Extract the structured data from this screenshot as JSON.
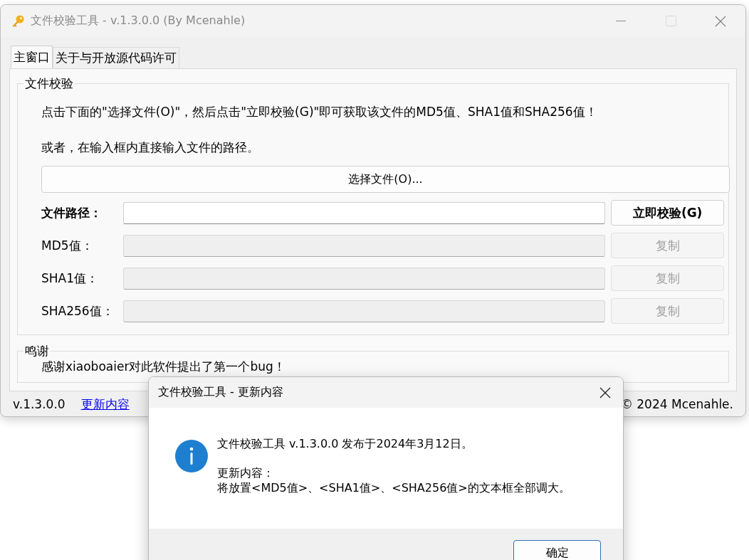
{
  "window": {
    "title": "文件校验工具 - v.1.3.0.0 (By Mcenahle)",
    "active": false,
    "maximize_disabled": true
  },
  "tabs": [
    {
      "label": "主窗口",
      "selected": true
    },
    {
      "label": "关于与开放源代码许可",
      "selected": false
    }
  ],
  "check_group": {
    "title": "文件校验",
    "lines": [
      "点击下面的\"选择文件(O)\"，然后点击\"立即校验(G)\"即可获取该文件的MD5值、SHA1值和SHA256值！",
      "或者，在输入框内直接输入文件的路径。"
    ],
    "choose_button": "选择文件(O)...",
    "path": {
      "label": "文件路径：",
      "button": "立即校验(G)"
    },
    "hashes": [
      {
        "label": "MD5值：",
        "button": "复制",
        "disabled": true
      },
      {
        "label": "SHA1值：",
        "button": "复制",
        "disabled": true
      },
      {
        "label": "SHA256值：",
        "button": "复制",
        "disabled": true
      }
    ]
  },
  "thanks_group": {
    "title": "鸣谢",
    "text": "感谢xiaoboaier对此软件提出了第一个bug！"
  },
  "status_bar": {
    "version": "v.1.3.0.0",
    "link": "更新内容",
    "copyright": "© 2024 Mcenahle."
  },
  "dialog": {
    "title": "文件校验工具 - 更新内容",
    "lines": [
      "文件校验工具 v.1.3.0.0 发布于2024年3月12日。",
      "更新内容：",
      "将放置<MD5值>、<SHA1值>、<SHA256值>的文本框全部调大。"
    ],
    "button": "确定"
  }
}
